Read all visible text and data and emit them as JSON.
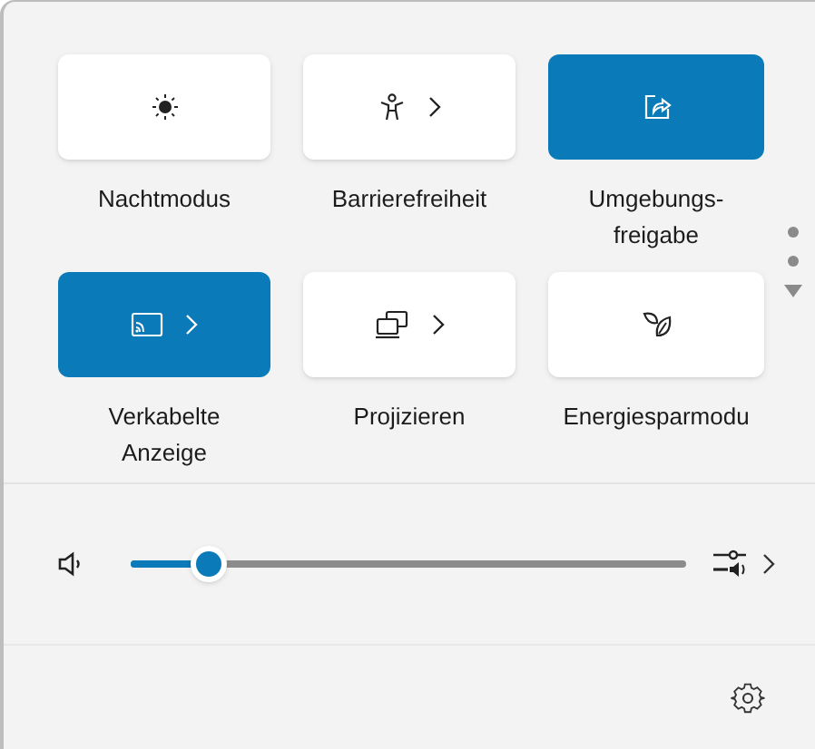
{
  "tiles": [
    {
      "label": "Nachtmodus",
      "on": false,
      "expandable": false
    },
    {
      "label": "Barrierefreiheit",
      "on": false,
      "expandable": true
    },
    {
      "label": "Umgebungs-\nfreigabe",
      "on": true,
      "expandable": false
    },
    {
      "label": "Verkabelte\nAnzeige",
      "on": true,
      "expandable": true
    },
    {
      "label": "Projizieren",
      "on": false,
      "expandable": true
    },
    {
      "label": "Energiesparmodu",
      "on": false,
      "expandable": false
    }
  ],
  "volume": {
    "level": 0.14
  }
}
